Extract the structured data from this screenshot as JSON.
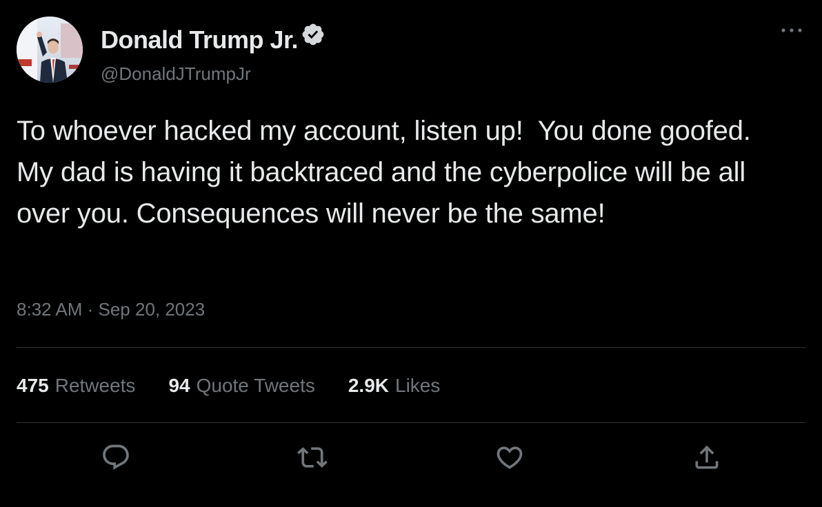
{
  "author": {
    "display_name": "Donald Trump Jr.",
    "handle": "@DonaldJTrumpJr",
    "verified_icon": "verified-badge-icon",
    "avatar_icon": "profile-photo"
  },
  "tweet": {
    "text": "To whoever hacked my account, listen up!  You done goofed. My dad is having it backtraced and the cyberpolice will be all over you. Consequences will never be the same!",
    "timestamp": "8:32 AM · Sep 20, 2023"
  },
  "stats": {
    "retweets": {
      "value": "475",
      "label": "Retweets"
    },
    "quotes": {
      "value": "94",
      "label": "Quote Tweets"
    },
    "likes": {
      "value": "2.9K",
      "label": "Likes"
    }
  },
  "actions": {
    "reply": "reply-icon",
    "retweet": "retweet-icon",
    "like": "heart-icon",
    "share": "share-icon",
    "more": "more-options-icon"
  },
  "colors": {
    "background": "#000000",
    "primary_text": "#e7e9ea",
    "secondary_text": "#71767b",
    "divider": "#2f3336"
  }
}
